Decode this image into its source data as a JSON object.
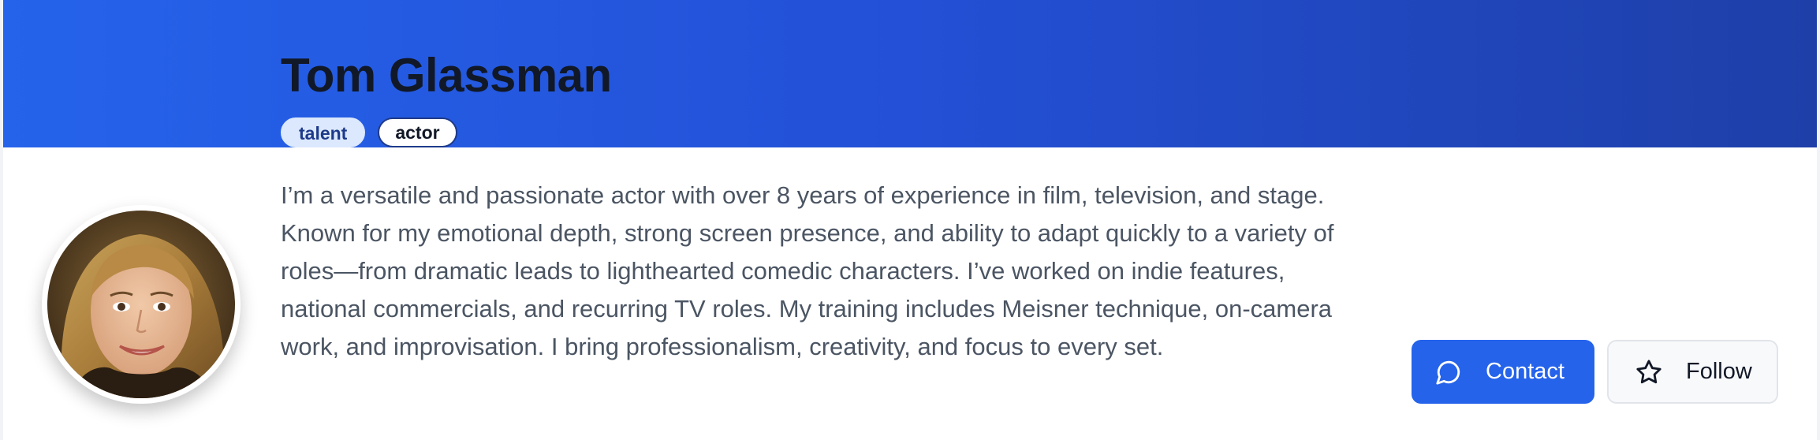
{
  "profile": {
    "name": "Tom Glassman",
    "tags": [
      "talent",
      "actor"
    ],
    "bio": "I’m a versatile and passionate actor with over 8 years of experience in film, television, and stage. Known for my emotional depth, strong screen presence, and ability to adapt quickly to a variety of roles—from dramatic leads to lighthearted comedic characters. I’ve worked on indie features, national commercials, and recurring TV roles. My training includes Meisner technique, on-camera work, and improvisation. I bring professionalism, creativity, and focus to every set."
  },
  "actions": {
    "contact_label": "Contact",
    "contact_icon": "chat-bubble-icon",
    "follow_label": "Follow",
    "follow_icon": "star-icon"
  },
  "colors": {
    "banner_start": "#2563eb",
    "banner_end": "#1e3fa8",
    "primary": "#2563eb",
    "tag_fill": "#dbe8fd"
  }
}
